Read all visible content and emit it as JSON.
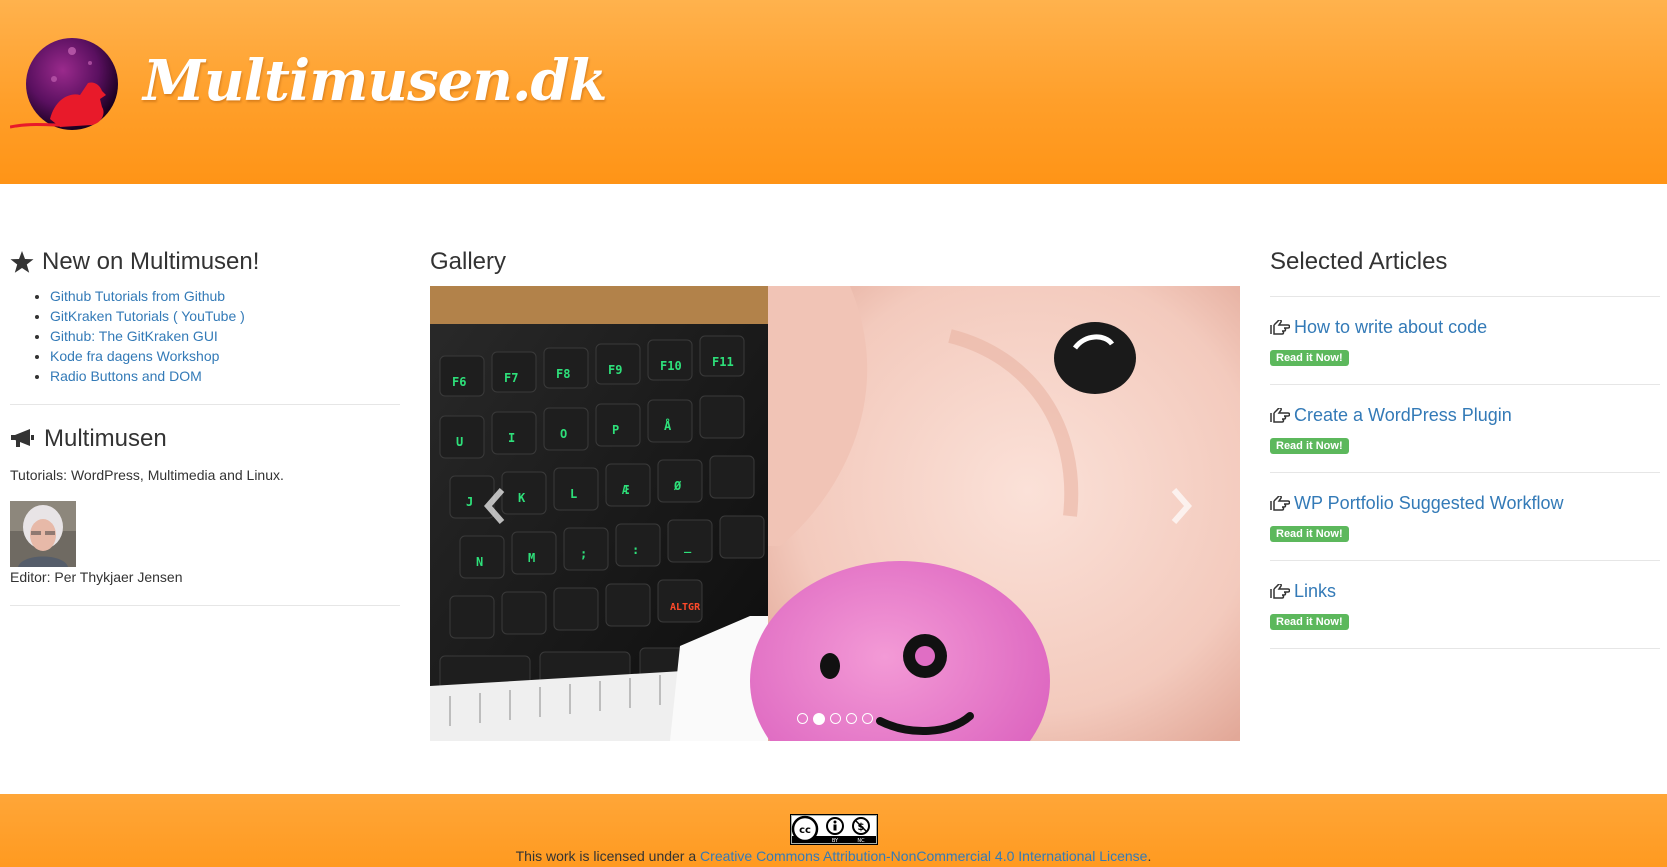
{
  "header": {
    "site_title": "Multimusen.dk"
  },
  "left": {
    "new_heading": "New on Multimusen!",
    "new_items": [
      "Github Tutorials from Github",
      "GitKraken Tutorials ( YouTube )",
      "Github: The GitKraken GUI",
      "Kode fra dagens Workshop",
      "Radio Buttons and DOM"
    ],
    "about_heading": "Multimusen",
    "about_text": "Tutorials: WordPress, Multimedia and Linux.",
    "editor": "Editor: Per Thykjaer Jensen"
  },
  "gallery": {
    "heading": "Gallery",
    "prev_icon": "chevron-left-icon",
    "next_icon": "chevron-right-icon",
    "indicator_count": 5,
    "active_indicator": 2
  },
  "articles": {
    "heading": "Selected Articles",
    "items": [
      {
        "title": "How to write about code",
        "badge": "Read it Now!"
      },
      {
        "title": "Create a WordPress Plugin",
        "badge": "Read it Now!"
      },
      {
        "title": "WP Portfolio Suggested Workflow",
        "badge": "Read it Now!"
      },
      {
        "title": "Links",
        "badge": "Read it Now!"
      }
    ]
  },
  "footer": {
    "license_prefix": "This work is licensed under a ",
    "license_link": "Creative Commons Attribution-NonCommercial 4.0 International License",
    "license_suffix": "."
  },
  "colors": {
    "header_orange": "#ff9f2a",
    "link_blue": "#337ab7",
    "badge_green": "#5cb85c"
  }
}
